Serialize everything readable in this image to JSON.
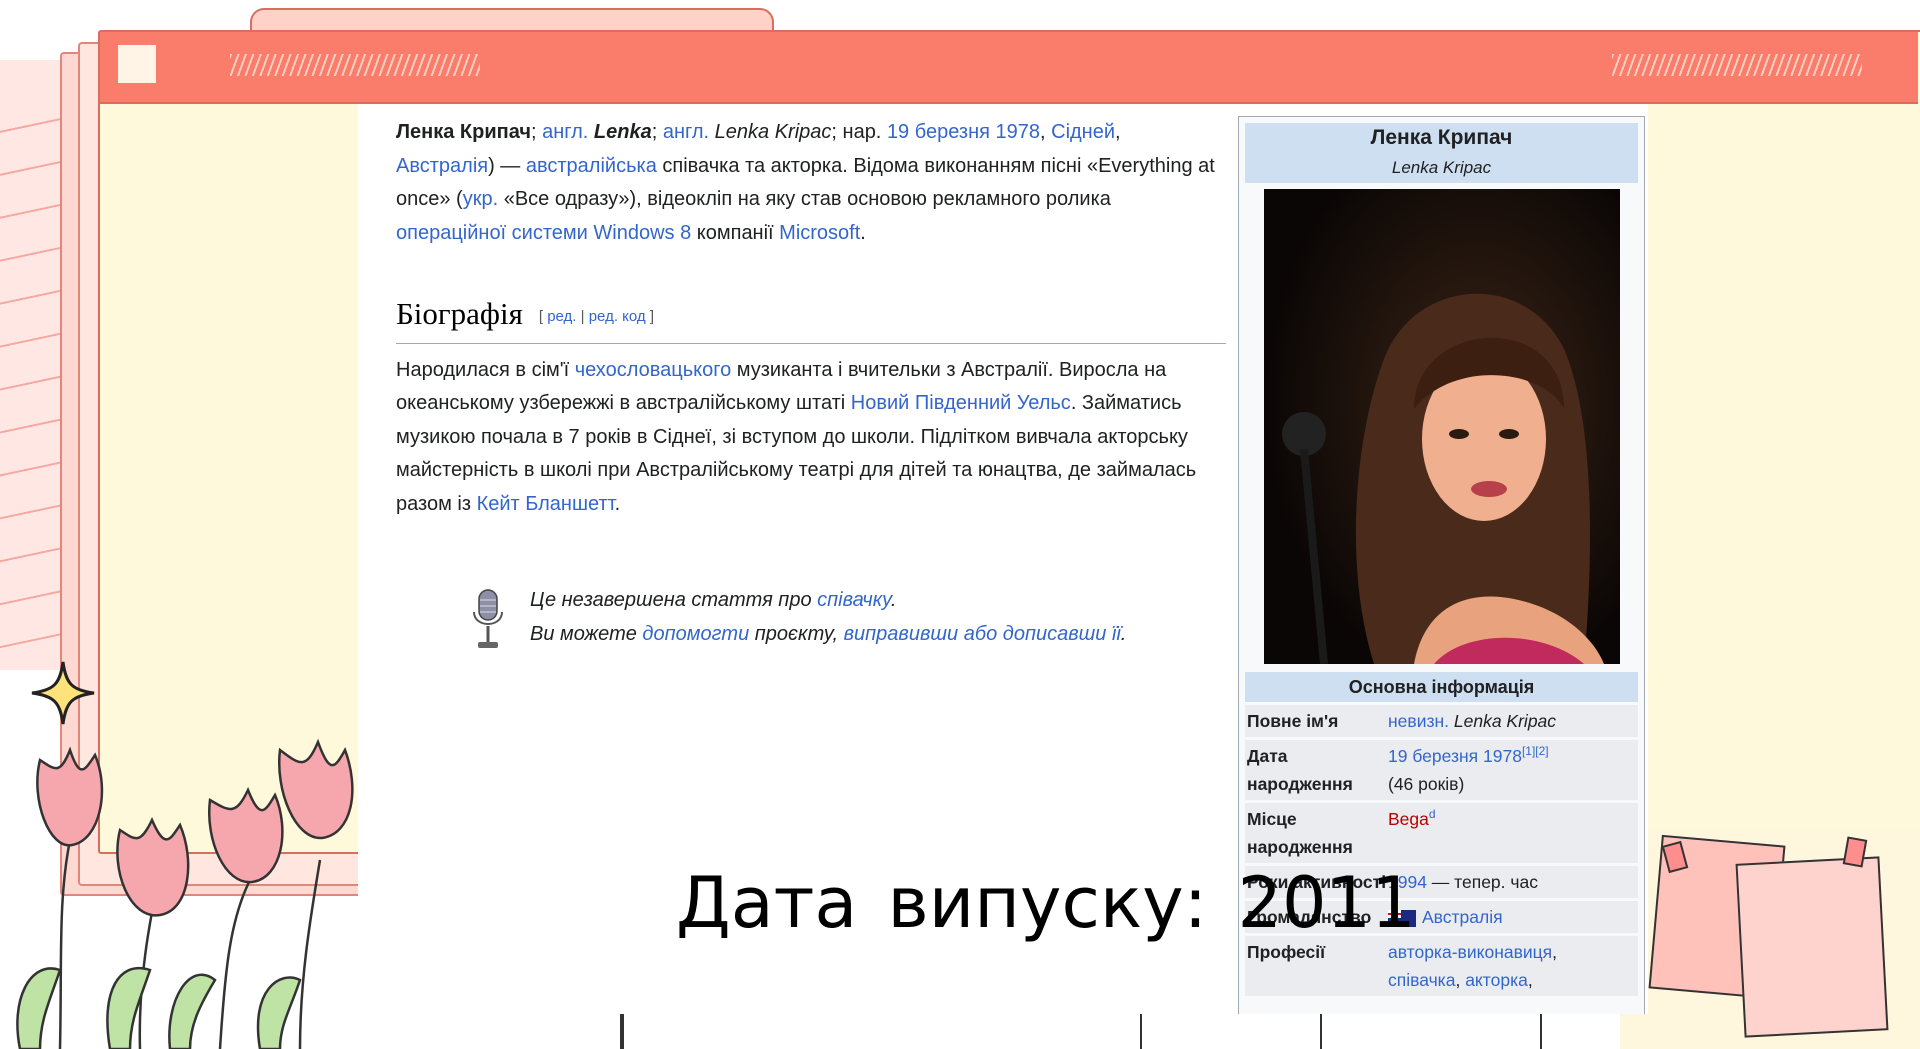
{
  "article": {
    "lead": {
      "name": "Ленка Крипач",
      "sep1": "; ",
      "lang_en_1": "англ.",
      "lenka": "Lenka",
      "sep2": "; ",
      "lang_en_2": "англ.",
      "full_en": "Lenka Kripac",
      "born_prefix": "; нар. ",
      "birth_date": "19 березня 1978",
      "comma1": ", ",
      "city": "Сідней",
      "comma2": ",",
      "country": "Австралія",
      "dash": ") — ",
      "nationality": "австралійська",
      "desc1": " співачка та акторка. Відома виконанням пісні «Everything at once» (",
      "lang_uk": "укр.",
      "desc2": " «Все одразу»), відеокліп на яку став основою рекламного ролика ",
      "os_link": "операційної системи Windows 8",
      "desc3": " компанії ",
      "ms_link": "Microsoft",
      "end": "."
    },
    "biography": {
      "heading": "Біографія",
      "edit_open": "[ ",
      "edit": "ред.",
      "edit_sep": " | ",
      "edit_code": "ред. код",
      "edit_close": " ]",
      "t1": "Народилася в сім'ї ",
      "link1": "чехословацького",
      "t2": " музиканта і вчительки з Австралії. Виросла на океанському узбережжі в австралійському штаті ",
      "link2": "Новий Південний Уельс",
      "t3": ". Займатись музикою почала в 7 років в Сіднеї, зі вступом до школи. Підлітком вивчала акторську майстерність в школі при Австралійському театрі для дітей та юнацтва, де займалась разом із ",
      "link3": "Кейт Бланшетт",
      "t4": "."
    },
    "stub": {
      "line1_text": "Це незавершена стаття про ",
      "line1_link": "співачку",
      "line1_end": ".",
      "line2_text": "Ви можете ",
      "line2_link1": "допомогти",
      "line2_mid": " проєкту, ",
      "line2_link2": "виправивши або дописавши її",
      "line2_end": "."
    }
  },
  "infobox": {
    "title": "Ленка Крипач",
    "subtitle": "Lenka Kripac",
    "section": "Основна інформація",
    "rows": {
      "full_name": {
        "label": "Повне ім'я",
        "prefix": "невизн.",
        "value": " Lenka Kripac"
      },
      "birth_date": {
        "label": "Дата народження",
        "link": "19 березня 1978",
        "refs": "[1][2]",
        "age": "(46 років)"
      },
      "birth_place": {
        "label": "Місце народження",
        "link": "Bega",
        "sup": "d"
      },
      "years_active": {
        "label": "Роки активності",
        "link": "1994",
        "rest": " — тепер. час"
      },
      "citizenship": {
        "label": "Громадянство",
        "link": "Австралія"
      },
      "professions": {
        "label": "Професії",
        "p1": "авторка-виконавиця",
        "c1": ",",
        "p2": "співачка",
        "c2": ", ",
        "p3": "акторка",
        "c3": ","
      }
    }
  },
  "caption": "Дата випуску: 2011",
  "icons": {
    "titlebar": "square-icon",
    "stub": "microphone-icon",
    "flag": "australia-flag-icon",
    "decor": [
      "sparkle-icon",
      "tulip-flowers-icon"
    ]
  },
  "colors": {
    "titlebar": "#fa7d6b",
    "frame": "#fff9dc",
    "link": "#3366cc",
    "redlink": "#ba0000",
    "infobox_header": "#cedff2"
  }
}
